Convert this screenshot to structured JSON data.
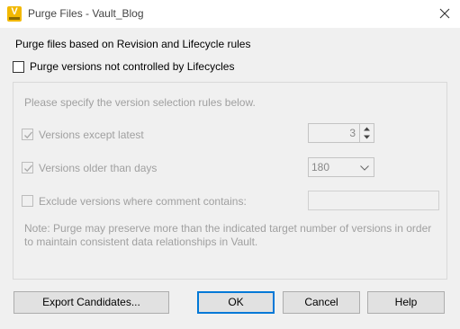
{
  "window": {
    "title": "Purge Files - Vault_Blog"
  },
  "heading": "Purge files based on Revision and Lifecycle rules",
  "purge_unlifecycled": {
    "label": "Purge versions not controlled by Lifecycles",
    "checked": false
  },
  "rules_group": {
    "instruction": "Please specify the version selection rules below.",
    "versions_except_latest": {
      "label": "Versions except latest",
      "checked": true,
      "value": "3"
    },
    "versions_older_than_days": {
      "label": "Versions older than days",
      "checked": true,
      "value": "180"
    },
    "exclude_comment": {
      "label": "Exclude versions where comment contains:",
      "checked": false,
      "value": ""
    },
    "note": "Note: Purge may preserve more than the indicated target number of versions in order to maintain consistent data relationships in Vault."
  },
  "buttons": {
    "export": "Export Candidates...",
    "ok": "OK",
    "cancel": "Cancel",
    "help": "Help"
  }
}
